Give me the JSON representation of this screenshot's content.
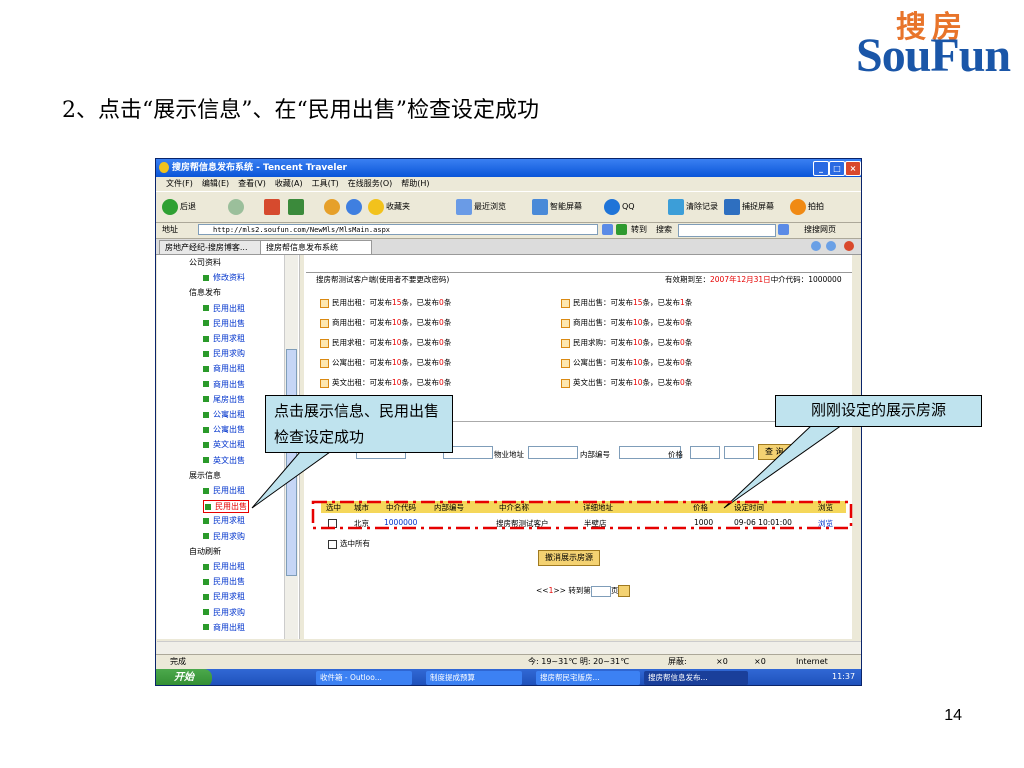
{
  "slide": {
    "title": "2、点击“展示信息”、在“民用出售”检查设定成功",
    "page_number": "14",
    "logo": {
      "cn": "搜房",
      "en": "SouFun"
    }
  },
  "window": {
    "title": "搜房帮信息发布系统 - Tencent Traveler",
    "menu": [
      "文件(F)",
      "编辑(E)",
      "查看(V)",
      "收藏(A)",
      "工具(T)",
      "在线服务(O)",
      "帮助(H)"
    ],
    "toolbar": {
      "back": "后退",
      "favorites": "收藏夹",
      "recent": "最近浏览",
      "smart_screen": "智能屏幕",
      "qq": "QQ",
      "clear": "清除记录",
      "capture": "捕捉屏幕",
      "snap": "拍拍"
    },
    "address_label": "地址",
    "address": "http://mls2.soufun.com/NewMls/MlsMain.aspx",
    "go": "转到",
    "search_label": "搜索",
    "search_web": "搜搜网页",
    "tabs": [
      "房地产经纪-搜房博客...",
      "搜房帮信息发布系统"
    ]
  },
  "tree": [
    {
      "label": "公司资料",
      "type": "node"
    },
    {
      "label": "修改资料",
      "type": "leaf"
    },
    {
      "label": "信息发布",
      "type": "node"
    },
    {
      "label": "民用出租",
      "type": "leaf"
    },
    {
      "label": "民用出售",
      "type": "leaf"
    },
    {
      "label": "民用求租",
      "type": "leaf"
    },
    {
      "label": "民用求购",
      "type": "leaf"
    },
    {
      "label": "商用出租",
      "type": "leaf"
    },
    {
      "label": "商用出售",
      "type": "leaf"
    },
    {
      "label": "尾房出售",
      "type": "leaf"
    },
    {
      "label": "公寓出租",
      "type": "leaf"
    },
    {
      "label": "公寓出售",
      "type": "leaf"
    },
    {
      "label": "英文出租",
      "type": "leaf"
    },
    {
      "label": "英文出售",
      "type": "leaf"
    },
    {
      "label": "展示信息",
      "type": "node"
    },
    {
      "label": "民用出租",
      "type": "leaf"
    },
    {
      "label": "民用出售",
      "type": "leaf"
    },
    {
      "label": "民用求租",
      "type": "leaf"
    },
    {
      "label": "民用求购",
      "type": "leaf"
    },
    {
      "label": "自动刷新",
      "type": "node"
    },
    {
      "label": "民用出租",
      "type": "leaf"
    },
    {
      "label": "民用出售",
      "type": "leaf"
    },
    {
      "label": "民用求租",
      "type": "leaf"
    },
    {
      "label": "民用求购",
      "type": "leaf"
    },
    {
      "label": "商用出租",
      "type": "leaf"
    }
  ],
  "main": {
    "client_title": "搜房帮测试客户端(使用者不要更改密码)",
    "validity_label": "有效期到至：",
    "validity_date": "2007年12月31日",
    "agent_code_label": "中介代码：",
    "agent_code": "1000000",
    "quotas_left": [
      {
        "label": "民用出租：可发布",
        "n1": "15",
        "mid": "条，已发布",
        "n2": "0",
        "end": "条"
      },
      {
        "label": "商用出租：可发布",
        "n1": "10",
        "mid": "条，已发布",
        "n2": "0",
        "end": "条"
      },
      {
        "label": "民用求租：可发布",
        "n1": "10",
        "mid": "条，已发布",
        "n2": "0",
        "end": "条"
      },
      {
        "label": "公寓出租：可发布",
        "n1": "10",
        "mid": "条，已发布",
        "n2": "0",
        "end": "条"
      },
      {
        "label": "英文出租：可发布",
        "n1": "10",
        "mid": "条，已发布",
        "n2": "0",
        "end": "条"
      }
    ],
    "quotas_right": [
      {
        "label": "民用出售：可发布",
        "n1": "15",
        "mid": "条，已发布",
        "n2": "1",
        "end": "条"
      },
      {
        "label": "商用出售：可发布",
        "n1": "10",
        "mid": "条，已发布",
        "n2": "0",
        "end": "条"
      },
      {
        "label": "民用求购：可发布",
        "n1": "10",
        "mid": "条，已发布",
        "n2": "0",
        "end": "条"
      },
      {
        "label": "公寓出售：可发布",
        "n1": "10",
        "mid": "条，已发布",
        "n2": "0",
        "end": "条"
      },
      {
        "label": "英文出售：可发布",
        "n1": "10",
        "mid": "条，已发布",
        "n2": "0",
        "end": "条"
      }
    ],
    "filter": {
      "property_addr": "物业地址",
      "internal_no": "内部编号",
      "price": "价格",
      "search_btn": "查 询"
    },
    "grid_headers": [
      "选中",
      "城市",
      "中介代码",
      "内部编号",
      "中介名称",
      "详细地址",
      "价格",
      "设定时间",
      "浏览"
    ],
    "grid_row": {
      "city": "北京",
      "agent_code": "1000000",
      "internal_no": "",
      "agent_name": "搜房帮测试客户",
      "address": "半壁店",
      "price": "1000",
      "time": "09-06 10:01:00",
      "view": "浏览"
    },
    "select_all": "选中所有",
    "cancel_btn": "撤消展示房源",
    "pager": {
      "prev": "<<",
      "page": "1",
      "next": ">>",
      "goto": "转到第",
      "unit": "页"
    }
  },
  "status": {
    "done": "完成",
    "weather": "今: 19~31℃  明: 20~31℃",
    "blocked": "屏蔽:",
    "x0a": "×0",
    "x0b": "×0",
    "zone": "Internet"
  },
  "taskbar": {
    "start": "开始",
    "tasks": [
      "收件箱 - Outloo...",
      "制度提成预算",
      "搜房帮民宅版房...",
      "搜房帮信息发布..."
    ],
    "clock": "11:37"
  },
  "callouts": {
    "left": "点击展示信息、民用出售检查设定成功",
    "right": "刚刚设定的展示房源"
  },
  "colors": {
    "callout_fill": "#bfe3ee",
    "highlight_red": "#e60000",
    "titlebar_blue": "#0a55d8",
    "grid_header": "#f5d75a"
  }
}
